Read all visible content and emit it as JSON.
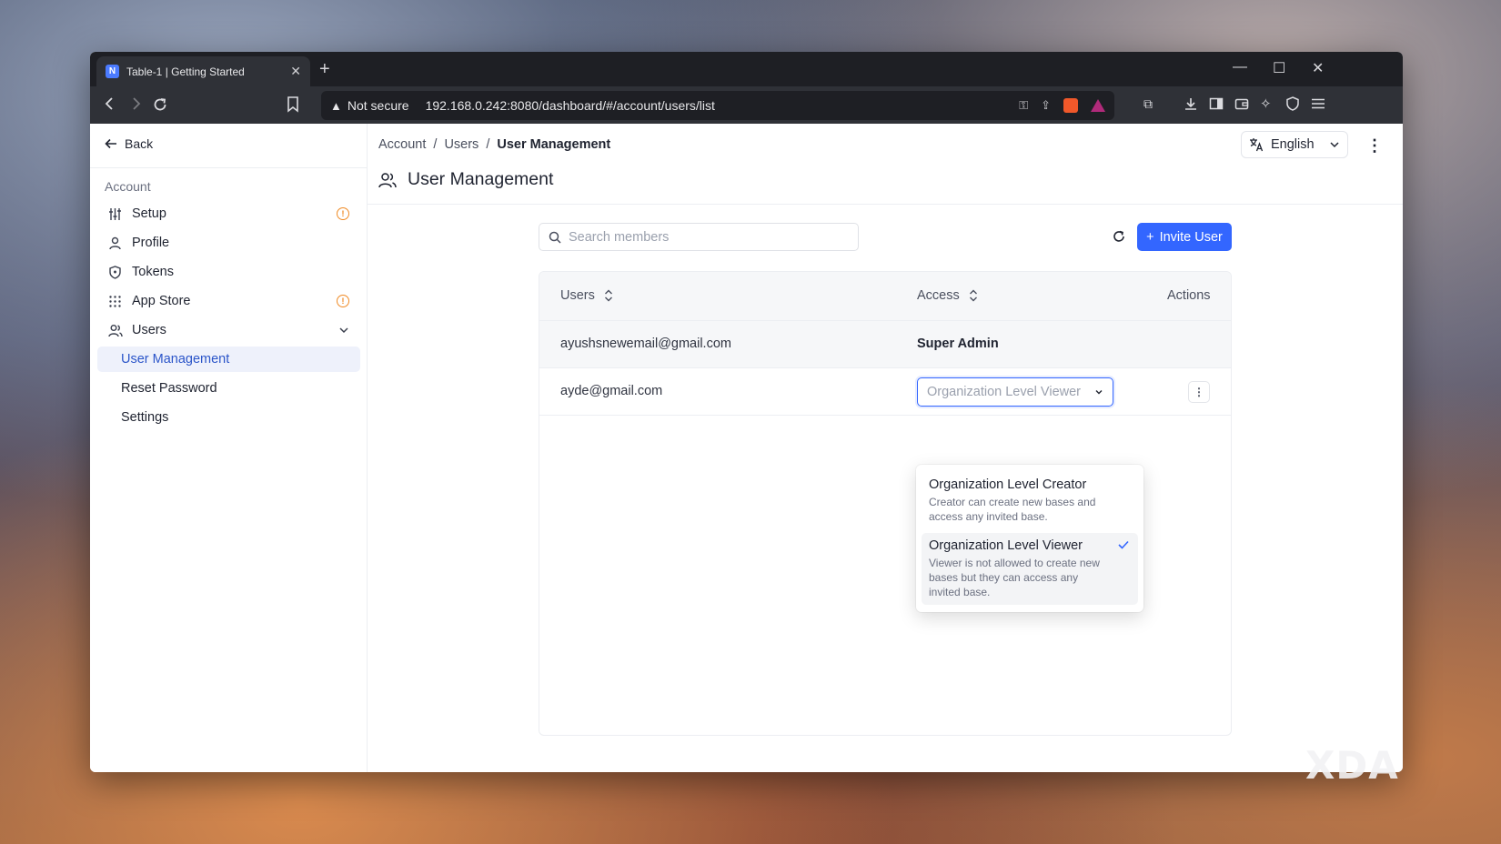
{
  "browser": {
    "tab_title": "Table-1 | Getting Started",
    "tab_favicon": "N",
    "new_tab": "+",
    "security_label": "Not secure",
    "url": "192.168.0.242:8080/dashboard/#/account/users/list"
  },
  "sidebar": {
    "back_label": "Back",
    "section_title": "Account",
    "items": [
      {
        "label": "Setup",
        "icon": "sliders-icon",
        "badge": "!"
      },
      {
        "label": "Profile",
        "icon": "user-icon"
      },
      {
        "label": "Tokens",
        "icon": "shield-icon"
      },
      {
        "label": "App Store",
        "icon": "grid-icon",
        "badge": "!"
      },
      {
        "label": "Users",
        "icon": "users-icon"
      }
    ],
    "subitems": [
      {
        "label": "User Management",
        "active": true
      },
      {
        "label": "Reset Password"
      },
      {
        "label": "Settings"
      }
    ]
  },
  "header": {
    "breadcrumb": [
      "Account",
      "Users",
      "User Management"
    ],
    "separator": "/",
    "language": "English",
    "page_title": "User Management"
  },
  "toolbar": {
    "search_placeholder": "Search members",
    "invite_label": "Invite User"
  },
  "table": {
    "columns": [
      "Users",
      "Access",
      "Actions"
    ],
    "rows": [
      {
        "email": "ayushsnewemail@gmail.com",
        "access": "Super Admin"
      },
      {
        "email": "ayde@gmail.com",
        "access": "Organization Level Viewer"
      }
    ]
  },
  "role_dropdown": {
    "options": [
      {
        "title": "Organization Level Creator",
        "desc": "Creator can create new bases and access any invited base.",
        "selected": false
      },
      {
        "title": "Organization Level Viewer",
        "desc": "Viewer is not allowed to create new bases but they can access any invited base.",
        "selected": true
      }
    ]
  },
  "watermark": "XDA",
  "colors": {
    "accent": "#3366ff",
    "warning": "#f08a24",
    "active_bg": "#eef1fb"
  }
}
